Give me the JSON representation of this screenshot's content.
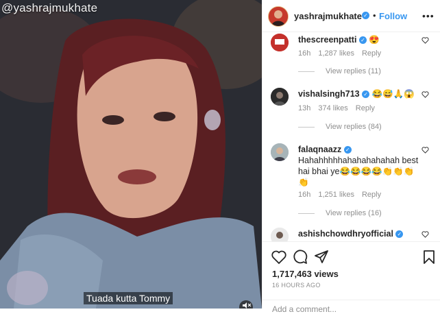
{
  "video": {
    "watermark": "@yashrajmukhate",
    "subtitle": "Tuada kutta Tommy",
    "mute_icon": "muted-speaker-icon"
  },
  "header": {
    "username": "yashrajmukhate",
    "separator": "•",
    "follow_label": "Follow",
    "more_icon": "ellipsis-icon"
  },
  "comments": [
    {
      "username": "thescreenpatti",
      "text": "😍",
      "time": "16h",
      "likes": "1,287 likes",
      "reply": "Reply",
      "view_replies": "View replies (11)"
    },
    {
      "username": "vishalsingh713",
      "text": "😂😅🙏😱",
      "time": "13h",
      "likes": "374 likes",
      "reply": "Reply",
      "view_replies": "View replies (84)"
    },
    {
      "username": "falaqnaazz",
      "text": "Hahahhhhhahahahahahah best hai bhai ye😂😂😂😂👏👏👏👏",
      "time": "16h",
      "likes": "1,251 likes",
      "reply": "Reply",
      "view_replies": "View replies (16)"
    },
    {
      "username": "ashishchowdhryofficial",
      "text": "",
      "time": "",
      "likes": "",
      "reply": "",
      "view_replies": ""
    }
  ],
  "actions": {
    "like_icon": "heart-icon",
    "comment_icon": "comment-bubble-icon",
    "share_icon": "paper-plane-icon",
    "save_icon": "bookmark-icon",
    "views": "1,717,463 views",
    "posted": "16 HOURS AGO",
    "add_comment_placeholder": "Add a comment..."
  },
  "colors": {
    "accent": "#3897f0",
    "text": "#262626",
    "muted": "#8e8e8e"
  }
}
